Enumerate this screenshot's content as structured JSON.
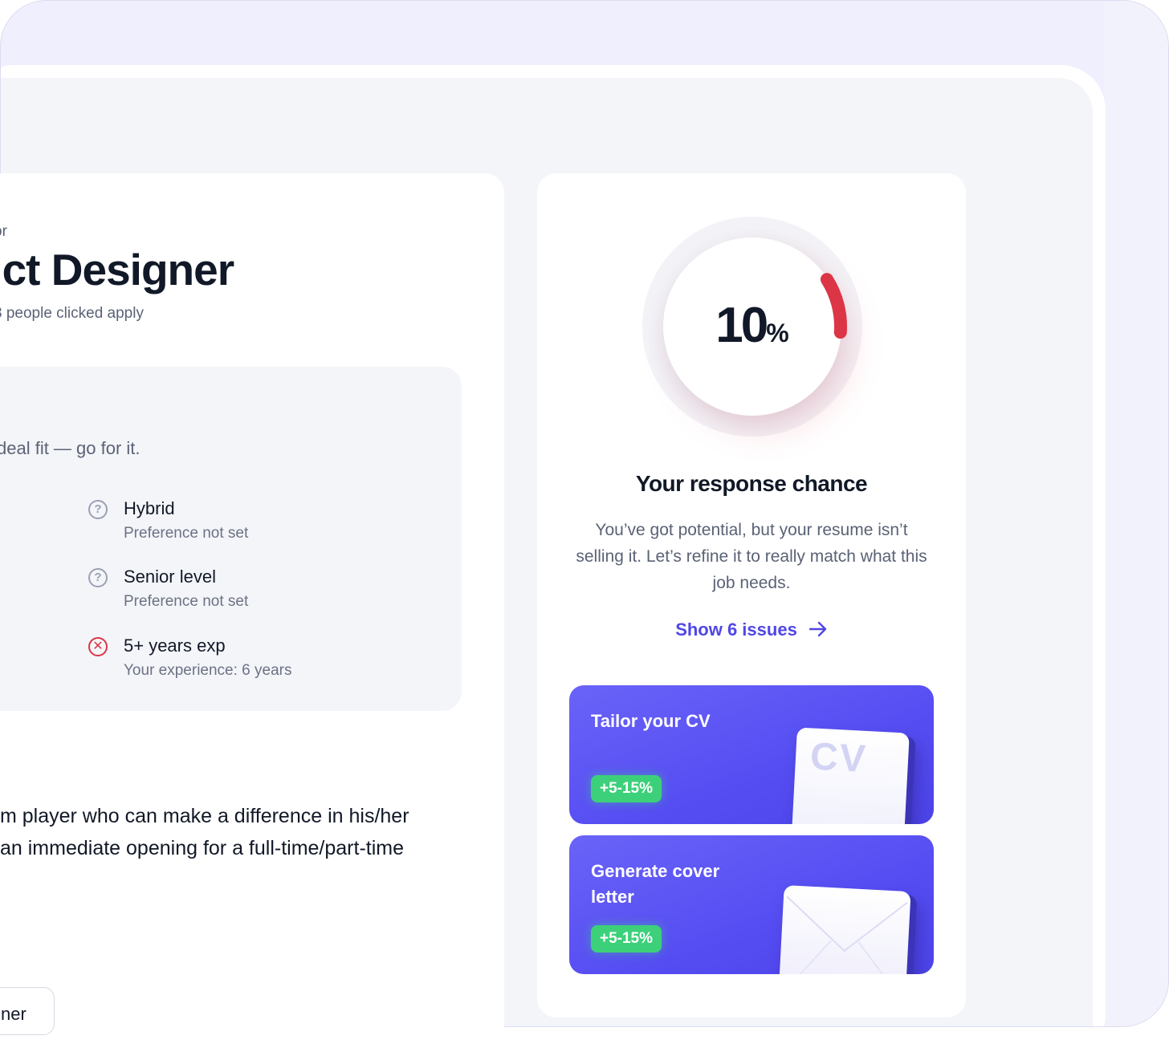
{
  "job": {
    "company_fragment": "or",
    "title": "uct Designer",
    "applicants": "3 people clicked apply"
  },
  "fit": {
    "summary": "deal fit — go for it.",
    "requirements": [
      {
        "label": "Hybrid",
        "sub": "Preference not set",
        "status": "unknown"
      },
      {
        "label": "Senior level",
        "sub": "Preference not set",
        "status": "unknown"
      },
      {
        "label": "5+ years exp",
        "sub": "Your experience: 6 years",
        "status": "mismatch"
      }
    ]
  },
  "description": {
    "lines": [
      "m player who can make a difference in his/her",
      " an immediate opening for a full-time/part-time"
    ]
  },
  "bottom_chip": {
    "label": "ner"
  },
  "score": {
    "value": "10",
    "unit": "%",
    "fraction": 0.1,
    "title": "Your response chance",
    "text": "You’ve got potential, but your resume isn’t selling it. Let’s refine it to really match what this job needs.",
    "link": "Show 6 issues",
    "ring_color": "#dc3545"
  },
  "actions": [
    {
      "title": "Tailor your CV",
      "badge": "+5-15%",
      "graphic": "CV"
    },
    {
      "title": "Generate cover letter",
      "badge": "+5-15%"
    }
  ],
  "colors": {
    "accent": "#5046e5",
    "action_bg": "#554df2",
    "badge": "#3dd07a",
    "danger": "#dc3545"
  }
}
